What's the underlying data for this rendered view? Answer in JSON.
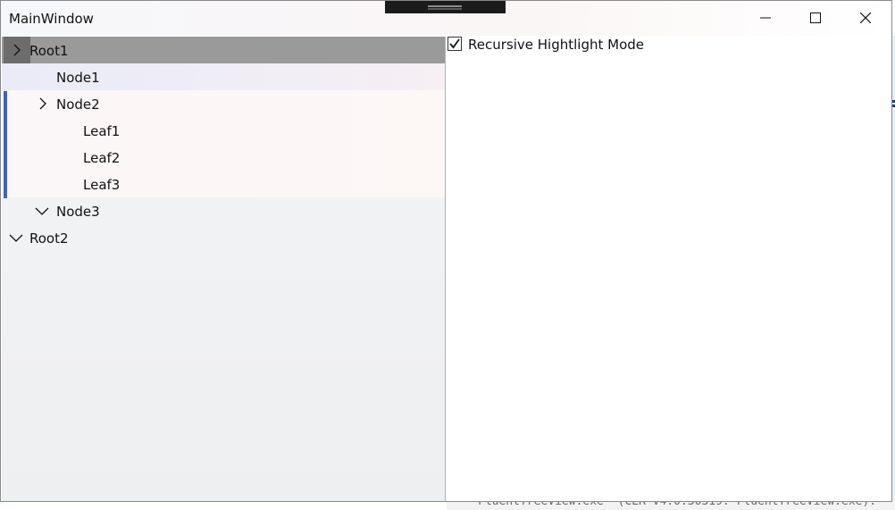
{
  "window": {
    "title": "MainWindow"
  },
  "tree": {
    "items": [
      {
        "label": "Root1",
        "level": 0,
        "expanded": false,
        "state": "selected"
      },
      {
        "label": "Node1",
        "level": 1,
        "expanded": null,
        "state": "hover"
      },
      {
        "label": "Node2",
        "level": 1,
        "expanded": false,
        "state": "highlighted"
      },
      {
        "label": "Leaf1",
        "level": 2,
        "expanded": null,
        "state": "highlighted"
      },
      {
        "label": "Leaf2",
        "level": 2,
        "expanded": null,
        "state": "highlighted"
      },
      {
        "label": "Leaf3",
        "level": 2,
        "expanded": null,
        "state": "highlighted"
      },
      {
        "label": "Node3",
        "level": 1,
        "expanded": true,
        "state": "normal"
      },
      {
        "label": "Root2",
        "level": 0,
        "expanded": true,
        "state": "normal"
      }
    ]
  },
  "options": {
    "recursive_highlight_label": "Recursive Hightlight Mode",
    "recursive_highlight_checked": true
  },
  "background_text": "FluentTreeView.exe' (CLR v4.0.30319: FluentTreeView.exe):",
  "colors": {
    "selected_row": "#9b9a9b",
    "selected_chevron_box": "#6e6d6e",
    "highlight_bar": "#3b63c8"
  },
  "icons": {
    "minimize": "minimize-icon",
    "maximize": "maximize-icon",
    "close": "close-icon",
    "chevron_right": "chevron-right-icon",
    "chevron_down": "chevron-down-icon",
    "checkmark": "checkmark-icon"
  }
}
